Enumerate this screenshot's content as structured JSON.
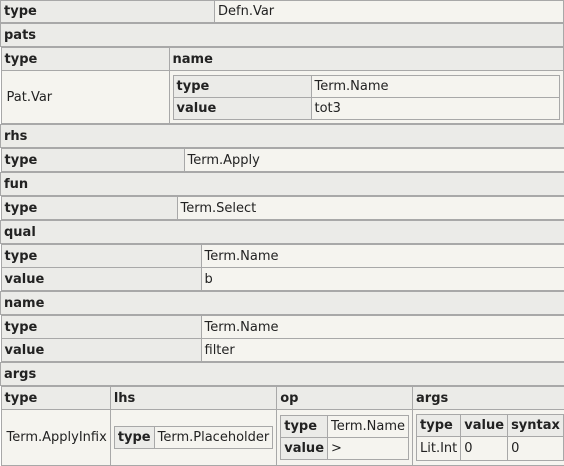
{
  "root": {
    "type_key": "type",
    "type_val": "Defn.Var"
  },
  "pats": {
    "label": "pats",
    "col_type": "type",
    "col_name": "name",
    "type_val": "Pat.Var",
    "name": {
      "type_key": "type",
      "type_val": "Term.Name",
      "value_key": "value",
      "value_val": "tot3"
    }
  },
  "rhs": {
    "label": "rhs",
    "type_key": "type",
    "type_val": "Term.Apply",
    "fun": {
      "label": "fun",
      "type_key": "type",
      "type_val": "Term.Select",
      "qual": {
        "label": "qual",
        "type_key": "type",
        "type_val": "Term.Name",
        "value_key": "value",
        "value_val": "b"
      },
      "name": {
        "label": "name",
        "type_key": "type",
        "type_val": "Term.Name",
        "value_key": "value",
        "value_val": "filter"
      }
    },
    "args": {
      "label": "args",
      "col_type": "type",
      "col_lhs": "lhs",
      "col_op": "op",
      "col_args": "args",
      "type_val": "Term.ApplyInfix",
      "lhs": {
        "type_key": "type",
        "type_val": "Term.Placeholder"
      },
      "op": {
        "type_key": "type",
        "type_val": "Term.Name",
        "value_key": "value",
        "value_val": ">"
      },
      "args": {
        "col_type": "type",
        "col_value": "value",
        "col_syntax": "syntax",
        "type_val": "Lit.Int",
        "value_val": "0",
        "syntax_val": "0"
      }
    }
  }
}
